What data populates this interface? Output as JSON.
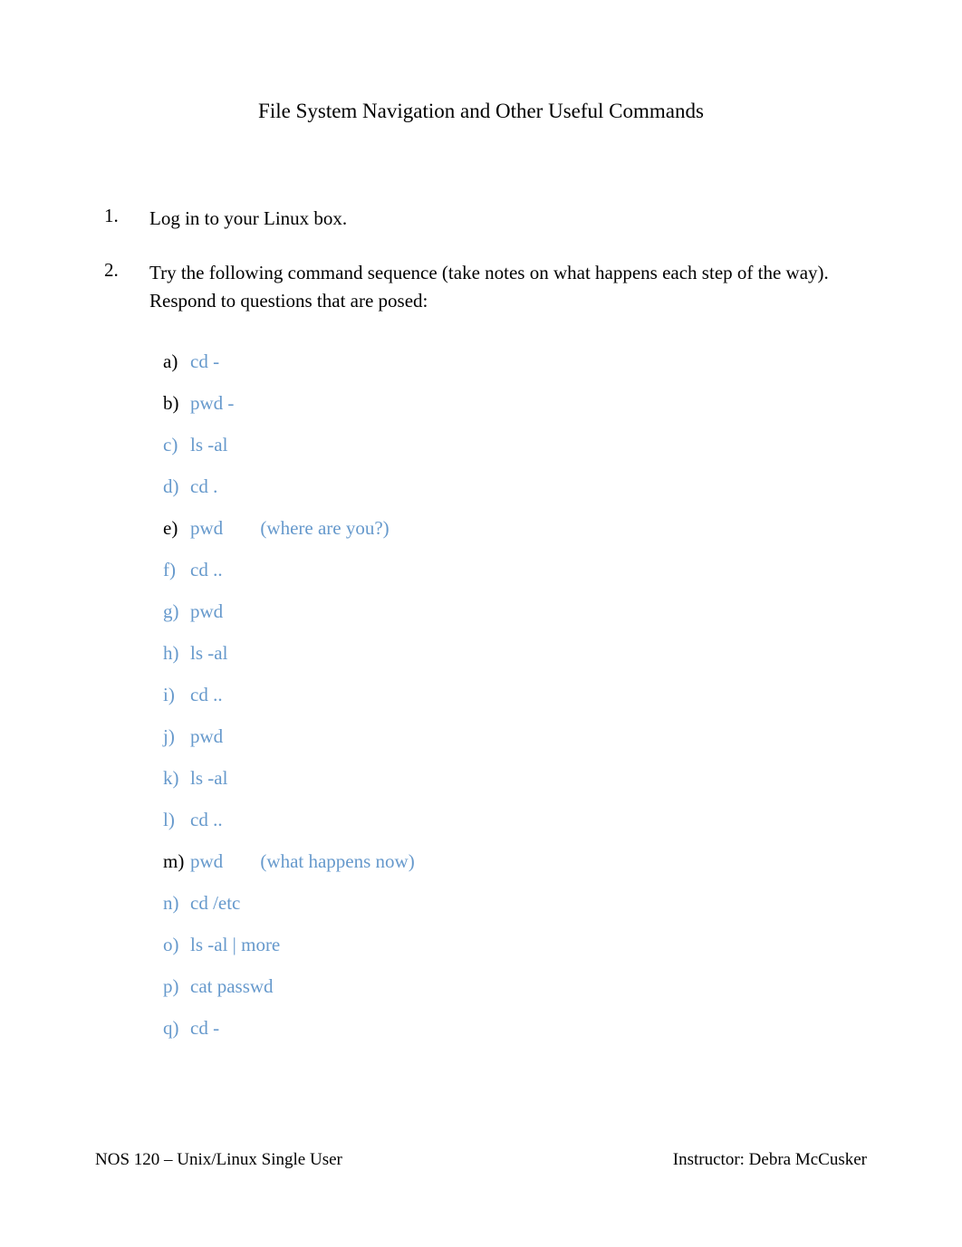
{
  "title": "File System Navigation and Other Useful Commands",
  "items": [
    {
      "number": "1.",
      "text": "Log in to your Linux box."
    },
    {
      "number": "2.",
      "text": "Try the following command sequence (take notes on what happens each step of the way). Respond to questions that are posed:",
      "sublist": [
        {
          "letter": "a)",
          "letter_black": true,
          "cmd": "cd  -",
          "note": ""
        },
        {
          "letter": "b)",
          "letter_black": true,
          "cmd": "pwd -",
          "note": ""
        },
        {
          "letter": "c)",
          "letter_black": false,
          "cmd": "ls -al",
          "note": ""
        },
        {
          "letter": "d)",
          "letter_black": false,
          "cmd": "cd .",
          "note": ""
        },
        {
          "letter": "e)",
          "letter_black": true,
          "cmd": "pwd",
          "note": "(where are you?)"
        },
        {
          "letter": "f)",
          "letter_black": false,
          "cmd": "cd ..",
          "note": ""
        },
        {
          "letter": "g)",
          "letter_black": false,
          "cmd": "pwd",
          "note": ""
        },
        {
          "letter": "h)",
          "letter_black": false,
          "cmd": "ls -al",
          "note": ""
        },
        {
          "letter": "i)",
          "letter_black": false,
          "cmd": "cd ..",
          "note": ""
        },
        {
          "letter": "j)",
          "letter_black": false,
          "cmd": "pwd",
          "note": ""
        },
        {
          "letter": "k)",
          "letter_black": false,
          "cmd": "ls -al",
          "note": ""
        },
        {
          "letter": "l)",
          "letter_black": false,
          "cmd": "cd ..",
          "note": ""
        },
        {
          "letter": "m)",
          "letter_black": true,
          "cmd": "pwd",
          "note": "(what happens now)"
        },
        {
          "letter": "n)",
          "letter_black": false,
          "cmd": "cd /etc",
          "note": ""
        },
        {
          "letter": "o)",
          "letter_black": false,
          "cmd": "ls -al | more",
          "note": ""
        },
        {
          "letter": "p)",
          "letter_black": false,
          "cmd": "cat passwd",
          "note": ""
        },
        {
          "letter": "q)",
          "letter_black": false,
          "cmd": "cd -",
          "note": ""
        }
      ]
    }
  ],
  "footer": {
    "left": "NOS 120 – Unix/Linux Single User",
    "right": "Instructor: Debra McCusker"
  }
}
